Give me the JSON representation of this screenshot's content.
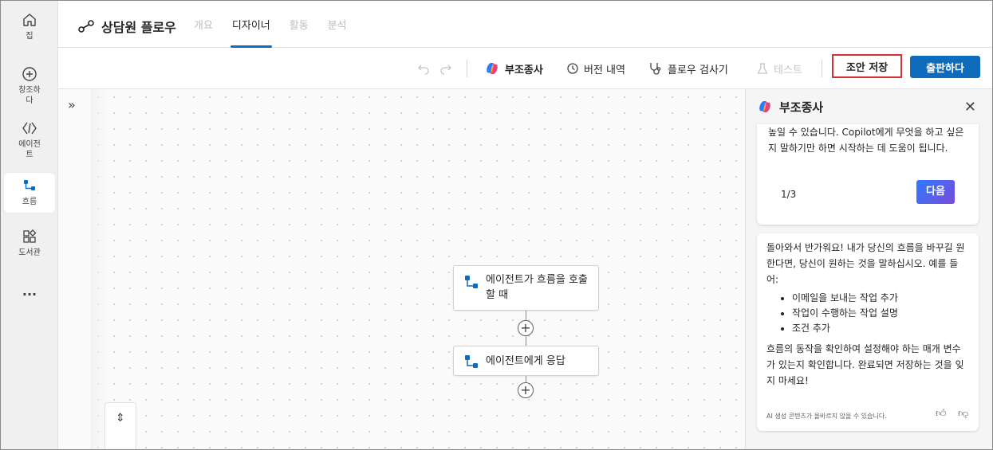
{
  "rail": {
    "items": [
      {
        "label": "집",
        "icon": "home-icon"
      },
      {
        "label": "창조하\n다",
        "icon": "create-icon"
      },
      {
        "label": "에이전\n트",
        "icon": "agents-icon"
      },
      {
        "label": "흐름",
        "icon": "flows-icon"
      },
      {
        "label": "도서관",
        "icon": "library-icon"
      },
      {
        "label": "...",
        "icon": "more-icon"
      }
    ]
  },
  "header": {
    "title": "상담원 플로우",
    "tabs": [
      {
        "label": "개요",
        "active": false
      },
      {
        "label": "디자이너",
        "active": true
      },
      {
        "label": "활동",
        "active": false
      },
      {
        "label": "분석",
        "active": false
      }
    ]
  },
  "toolbar": {
    "copilot_label": "부조종사",
    "history_label": "버전 내역",
    "checker_label": "플로우 검사기",
    "test_label": "테스트",
    "save_draft_label": "조안 저장",
    "publish_label": "출판하다"
  },
  "canvas": {
    "trigger_node": "에이전트가 흐름을 호출할 때",
    "response_node": "에이전트에게 응답"
  },
  "panel": {
    "title": "부조종사",
    "card1_text": "높일 수 있습니다. Copilot에게 무엇을 하고 싶은지 말하기만 하면 시작하는 데 도움이 됩니다.",
    "pager": "1/3",
    "next_label": "다음",
    "card2_intro": "돌아와서 반가워요! 내가 당신의 흐름을 바꾸길 원한다면, 당신이 원하는 것을 말하십시오. 예를 들어:",
    "card2_bullets": [
      "이메일을 보내는 작업 추가",
      "작업이 수행하는 작업 설명",
      "조건 추가"
    ],
    "card2_outro": "흐름의 동작을 확인하여 설정해야 하는 매개 변수가 있는지 확인합니다. 완료되면 저장하는 것을 잊지 마세요!",
    "ai_note": "AI 생성 콘텐츠가 올바르지 않을 수 있습니다."
  },
  "colors": {
    "accent": "#0f6cbd",
    "highlight": "#d13438"
  }
}
